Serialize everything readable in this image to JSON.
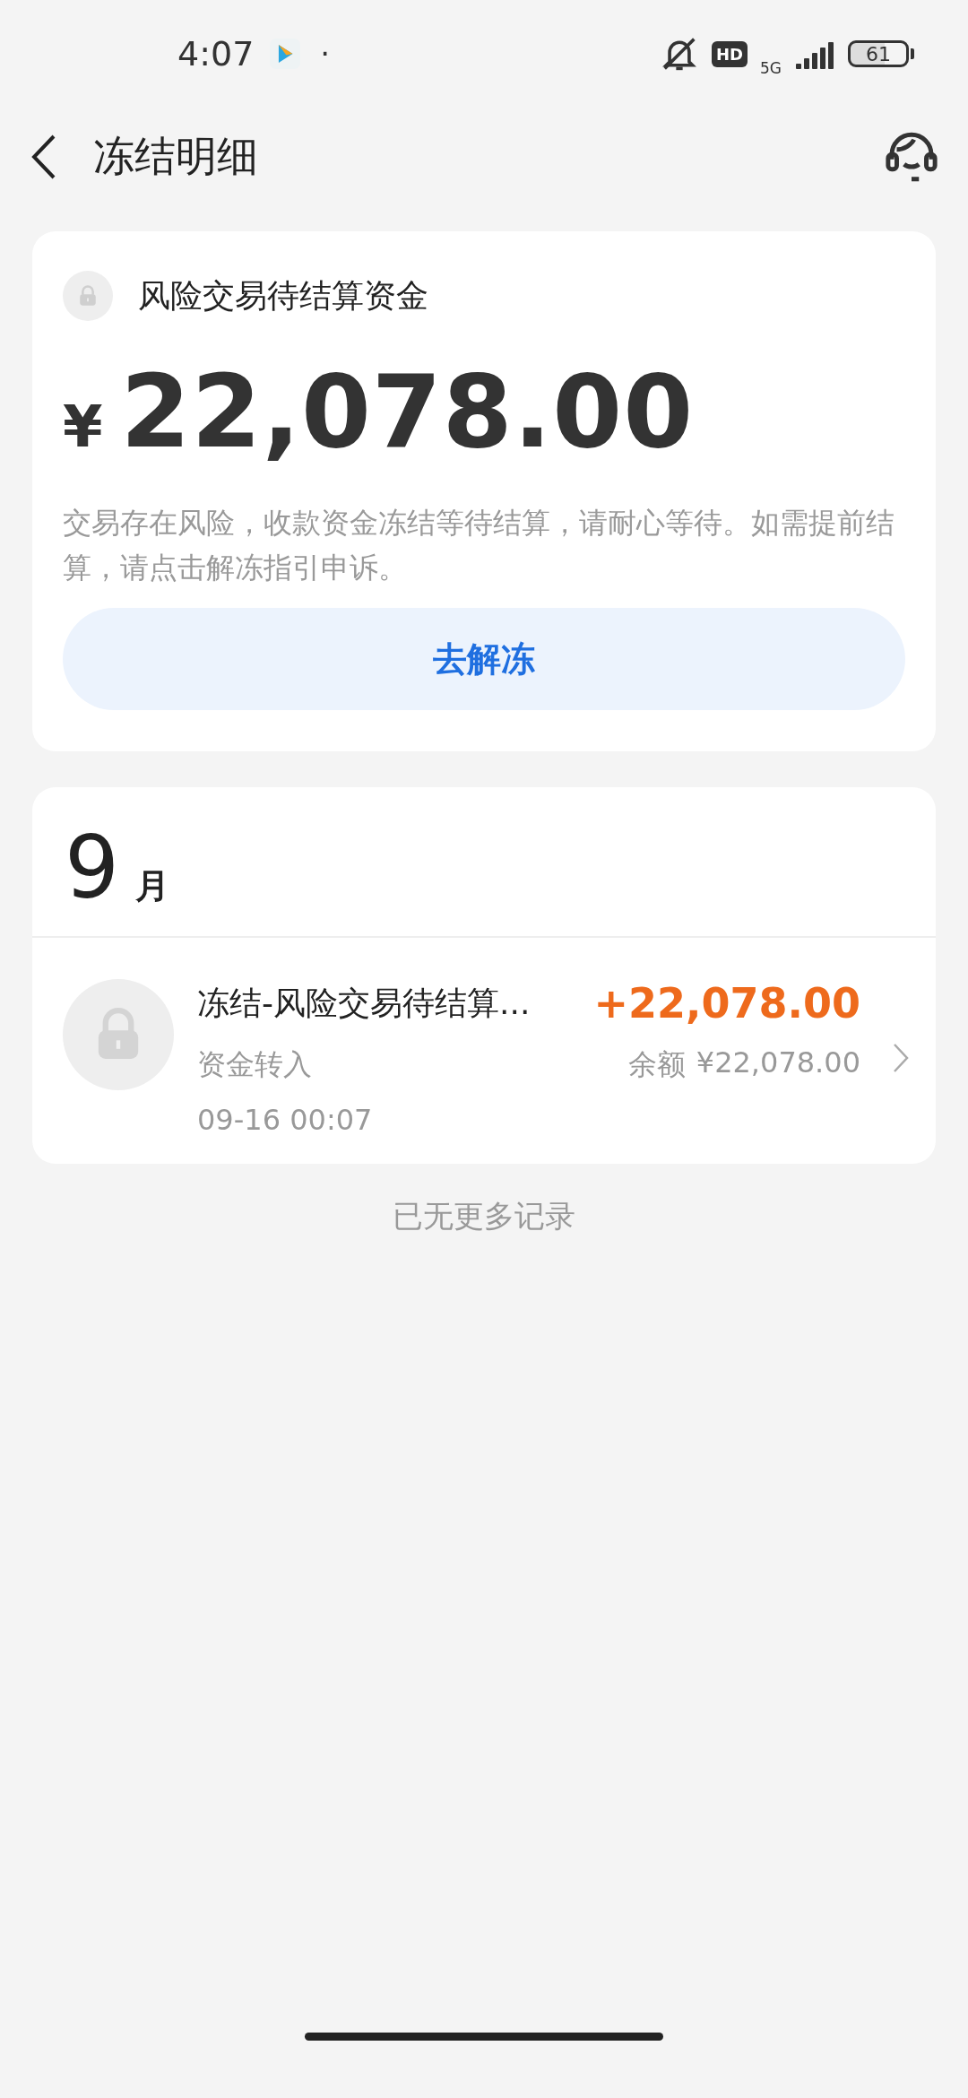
{
  "status_bar": {
    "time": "4:07",
    "notification_dot": "·",
    "hd_badge": "HD",
    "network": "5G",
    "battery": "61"
  },
  "header": {
    "title": "冻结明细"
  },
  "summary_card": {
    "title": "风险交易待结算资金",
    "currency": "¥",
    "amount": "22,078.00",
    "description": "交易存在风险，收款资金冻结等待结算，请耐心等待。如需提前结算，请点击解冻指引申诉。",
    "button": "去解冻"
  },
  "records": {
    "month_number": "9",
    "month_unit": "月",
    "items": [
      {
        "title": "冻结-风险交易待结算...",
        "amount": "+22,078.00",
        "type": "资金转入",
        "balance_label": "余额",
        "balance": "¥22,078.00",
        "time": "09-16 00:07"
      }
    ]
  },
  "footer": "已无更多记录"
}
